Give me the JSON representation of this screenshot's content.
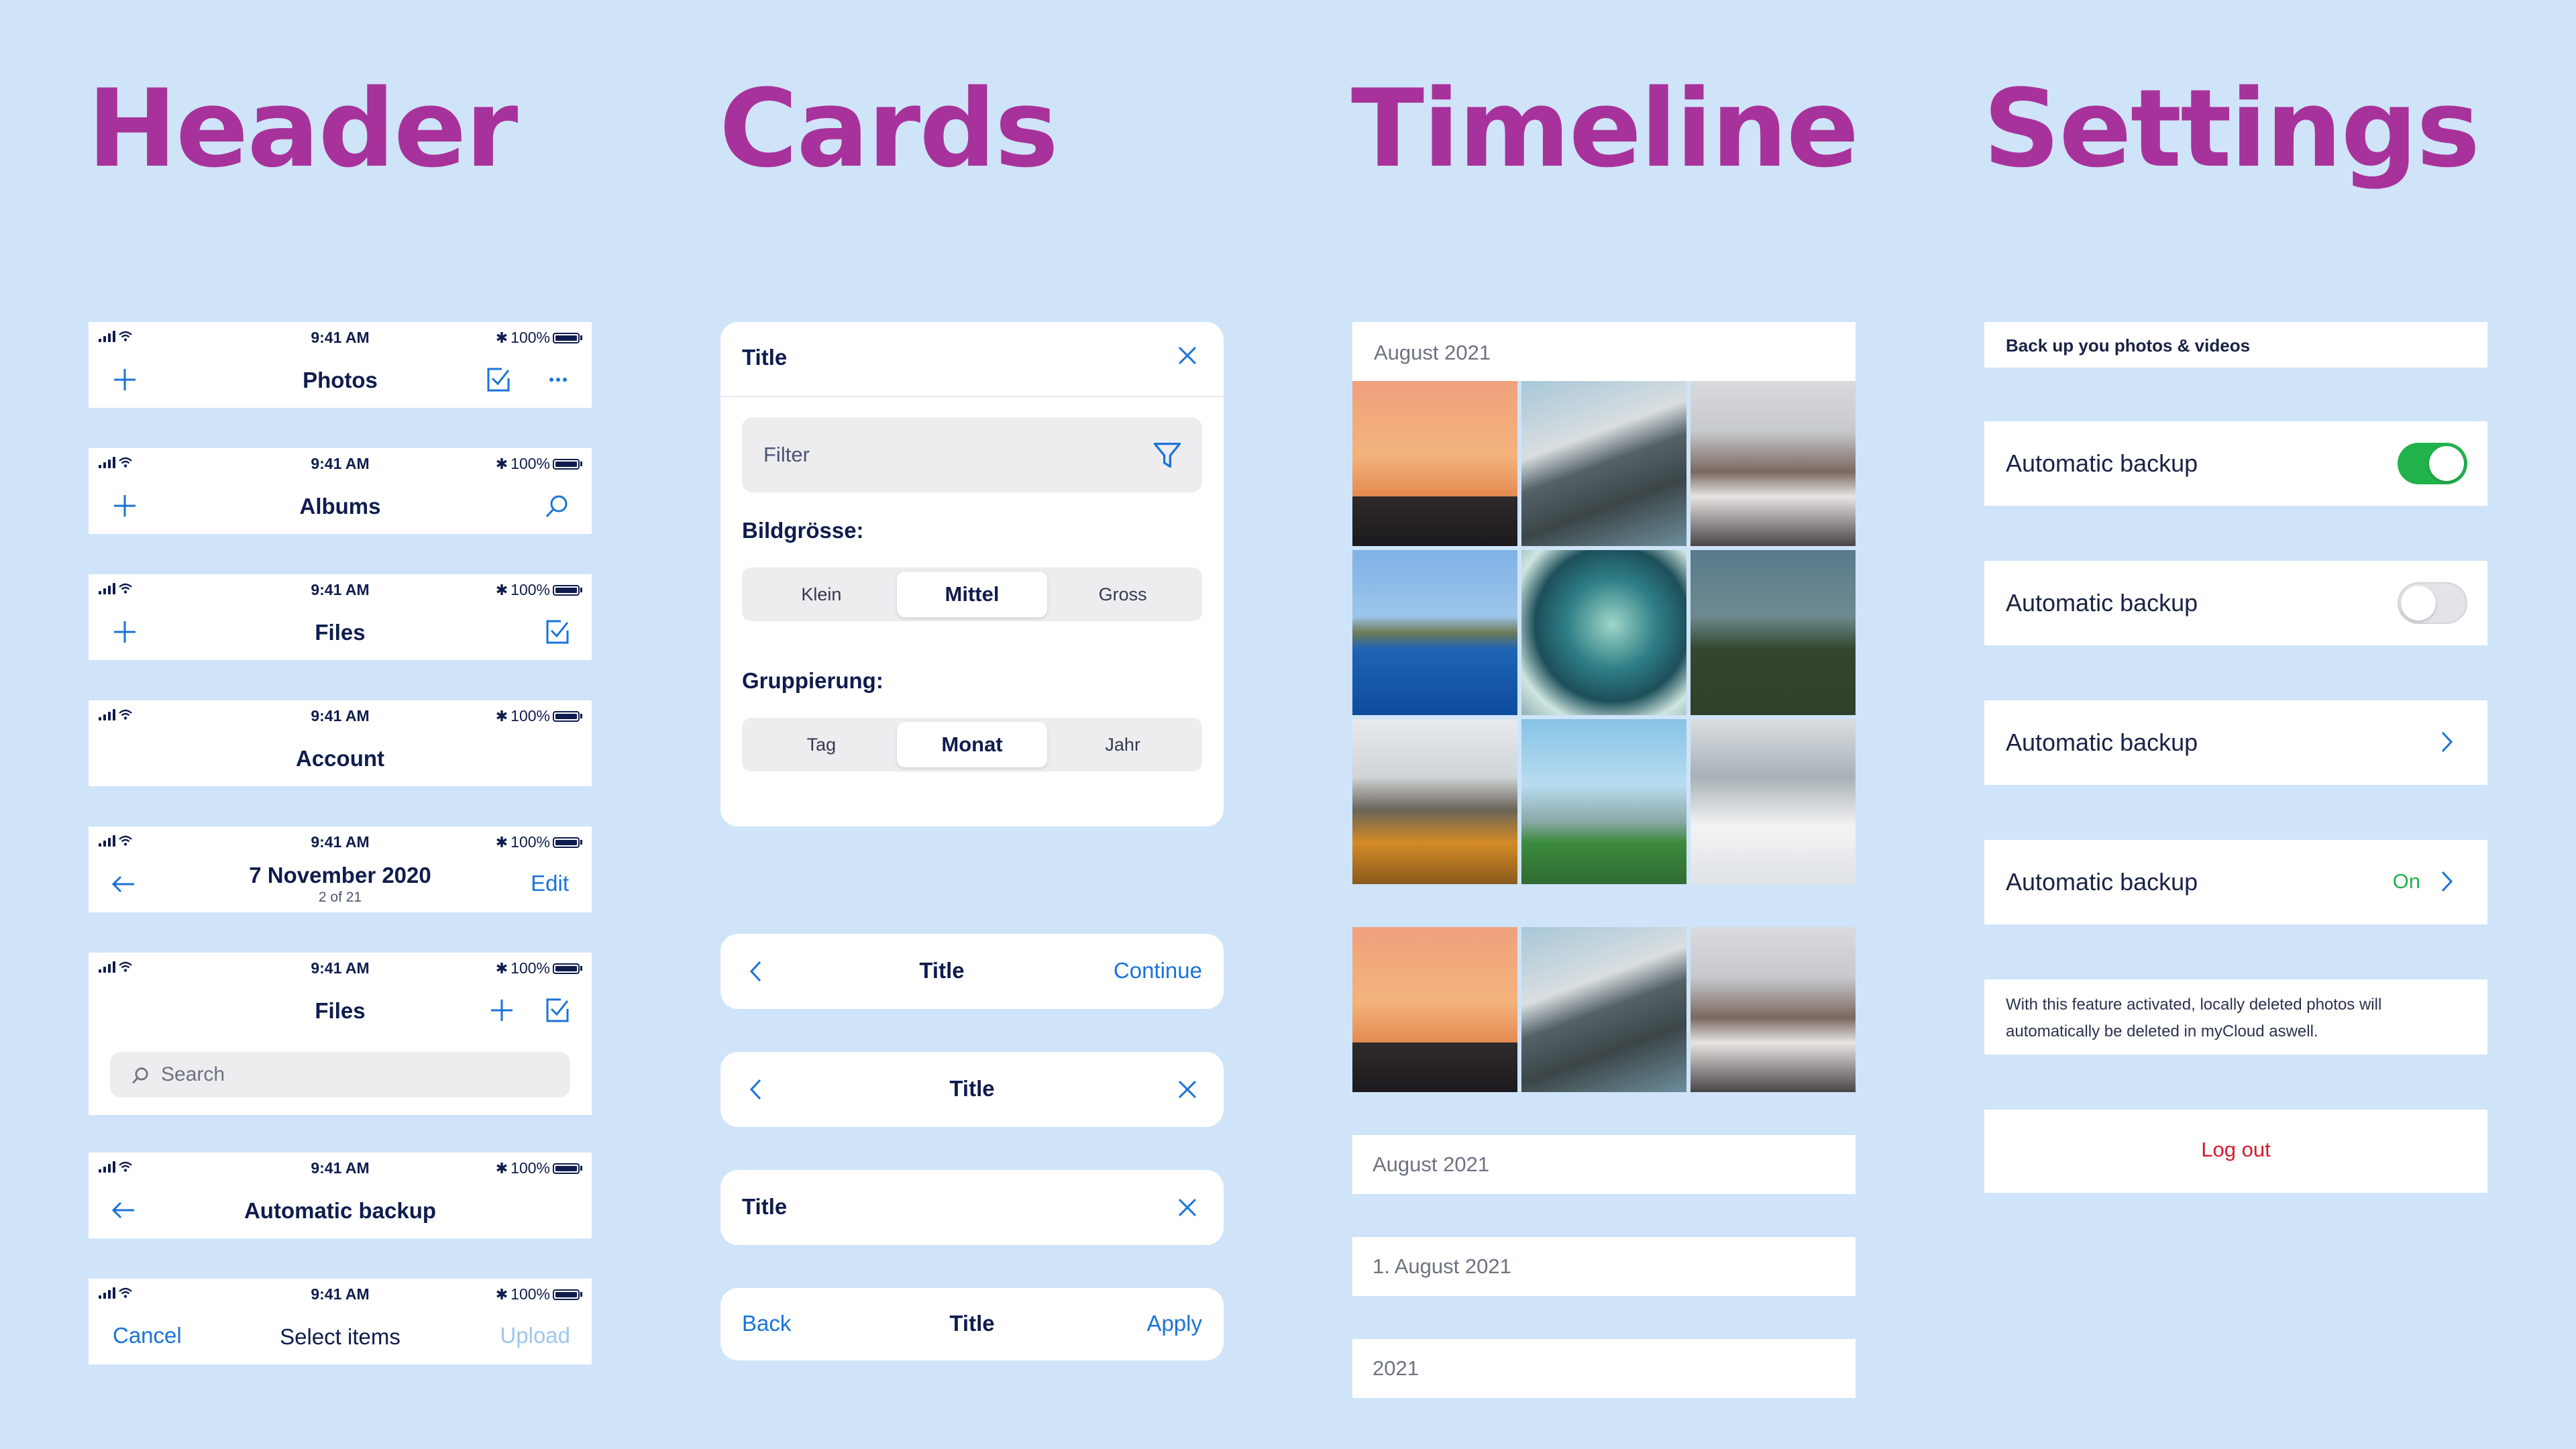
{
  "headings": {
    "header": "Header",
    "cards": "Cards",
    "timeline": "Timeline",
    "settings": "Settings"
  },
  "status_bar": {
    "time": "9:41 AM",
    "battery": "100%"
  },
  "headers": {
    "h1": {
      "title": "Photos"
    },
    "h2": {
      "title": "Albums"
    },
    "h3": {
      "title": "Files"
    },
    "h4": {
      "title": "Account"
    },
    "h5": {
      "title": "7 November 2020",
      "subtitle": "2 of 21",
      "right": "Edit"
    },
    "h6": {
      "title": "Files",
      "search_placeholder": "Search"
    },
    "h7": {
      "title": "Automatic backup"
    },
    "h8": {
      "left": "Cancel",
      "title": "Select items",
      "right": "Upload"
    }
  },
  "cards": {
    "filter_card": {
      "title": "Title",
      "filter_placeholder": "Filter",
      "size_label": "Bildgrösse:",
      "size_options": [
        "Klein",
        "Mittel",
        "Gross"
      ],
      "size_selected": "Mittel",
      "group_label": "Gruppierung:",
      "group_options": [
        "Tag",
        "Monat",
        "Jahr"
      ],
      "group_selected": "Monat"
    },
    "c2": {
      "title": "Title",
      "right": "Continue"
    },
    "c3": {
      "title": "Title"
    },
    "c4": {
      "title": "Title"
    },
    "c5": {
      "left": "Back",
      "title": "Title",
      "right": "Apply"
    }
  },
  "timeline": {
    "grid_header": "August 2021",
    "photos": [
      "sunset-photo",
      "mountain-lake-photo",
      "snowy-peak-photo",
      "island-photo",
      "surfer-wave-photo",
      "forest-meadow-photo",
      "coast-grass-photo",
      "green-field-photo",
      "snowy-forest-photo"
    ],
    "bar1": "August 2021",
    "bar2": "1. August 2021",
    "bar3": "2021"
  },
  "settings": {
    "section_title": "Back up you photos & videos",
    "rows": [
      {
        "label": "Automatic backup",
        "toggle": true
      },
      {
        "label": "Automatic backup",
        "toggle": false
      },
      {
        "label": "Automatic backup"
      },
      {
        "label": "Automatic backup",
        "value": "On"
      }
    ],
    "info": "With this feature activated, locally deleted photos will automatically be deleted in myCloud aswell.",
    "logout": "Log out"
  },
  "colors": {
    "background": "#cfe4f8",
    "heading": "#a8329b",
    "accent": "#1a73d9",
    "ink": "#0f1c4d",
    "toggle_on": "#22b24c",
    "logout": "#d61a2c"
  }
}
